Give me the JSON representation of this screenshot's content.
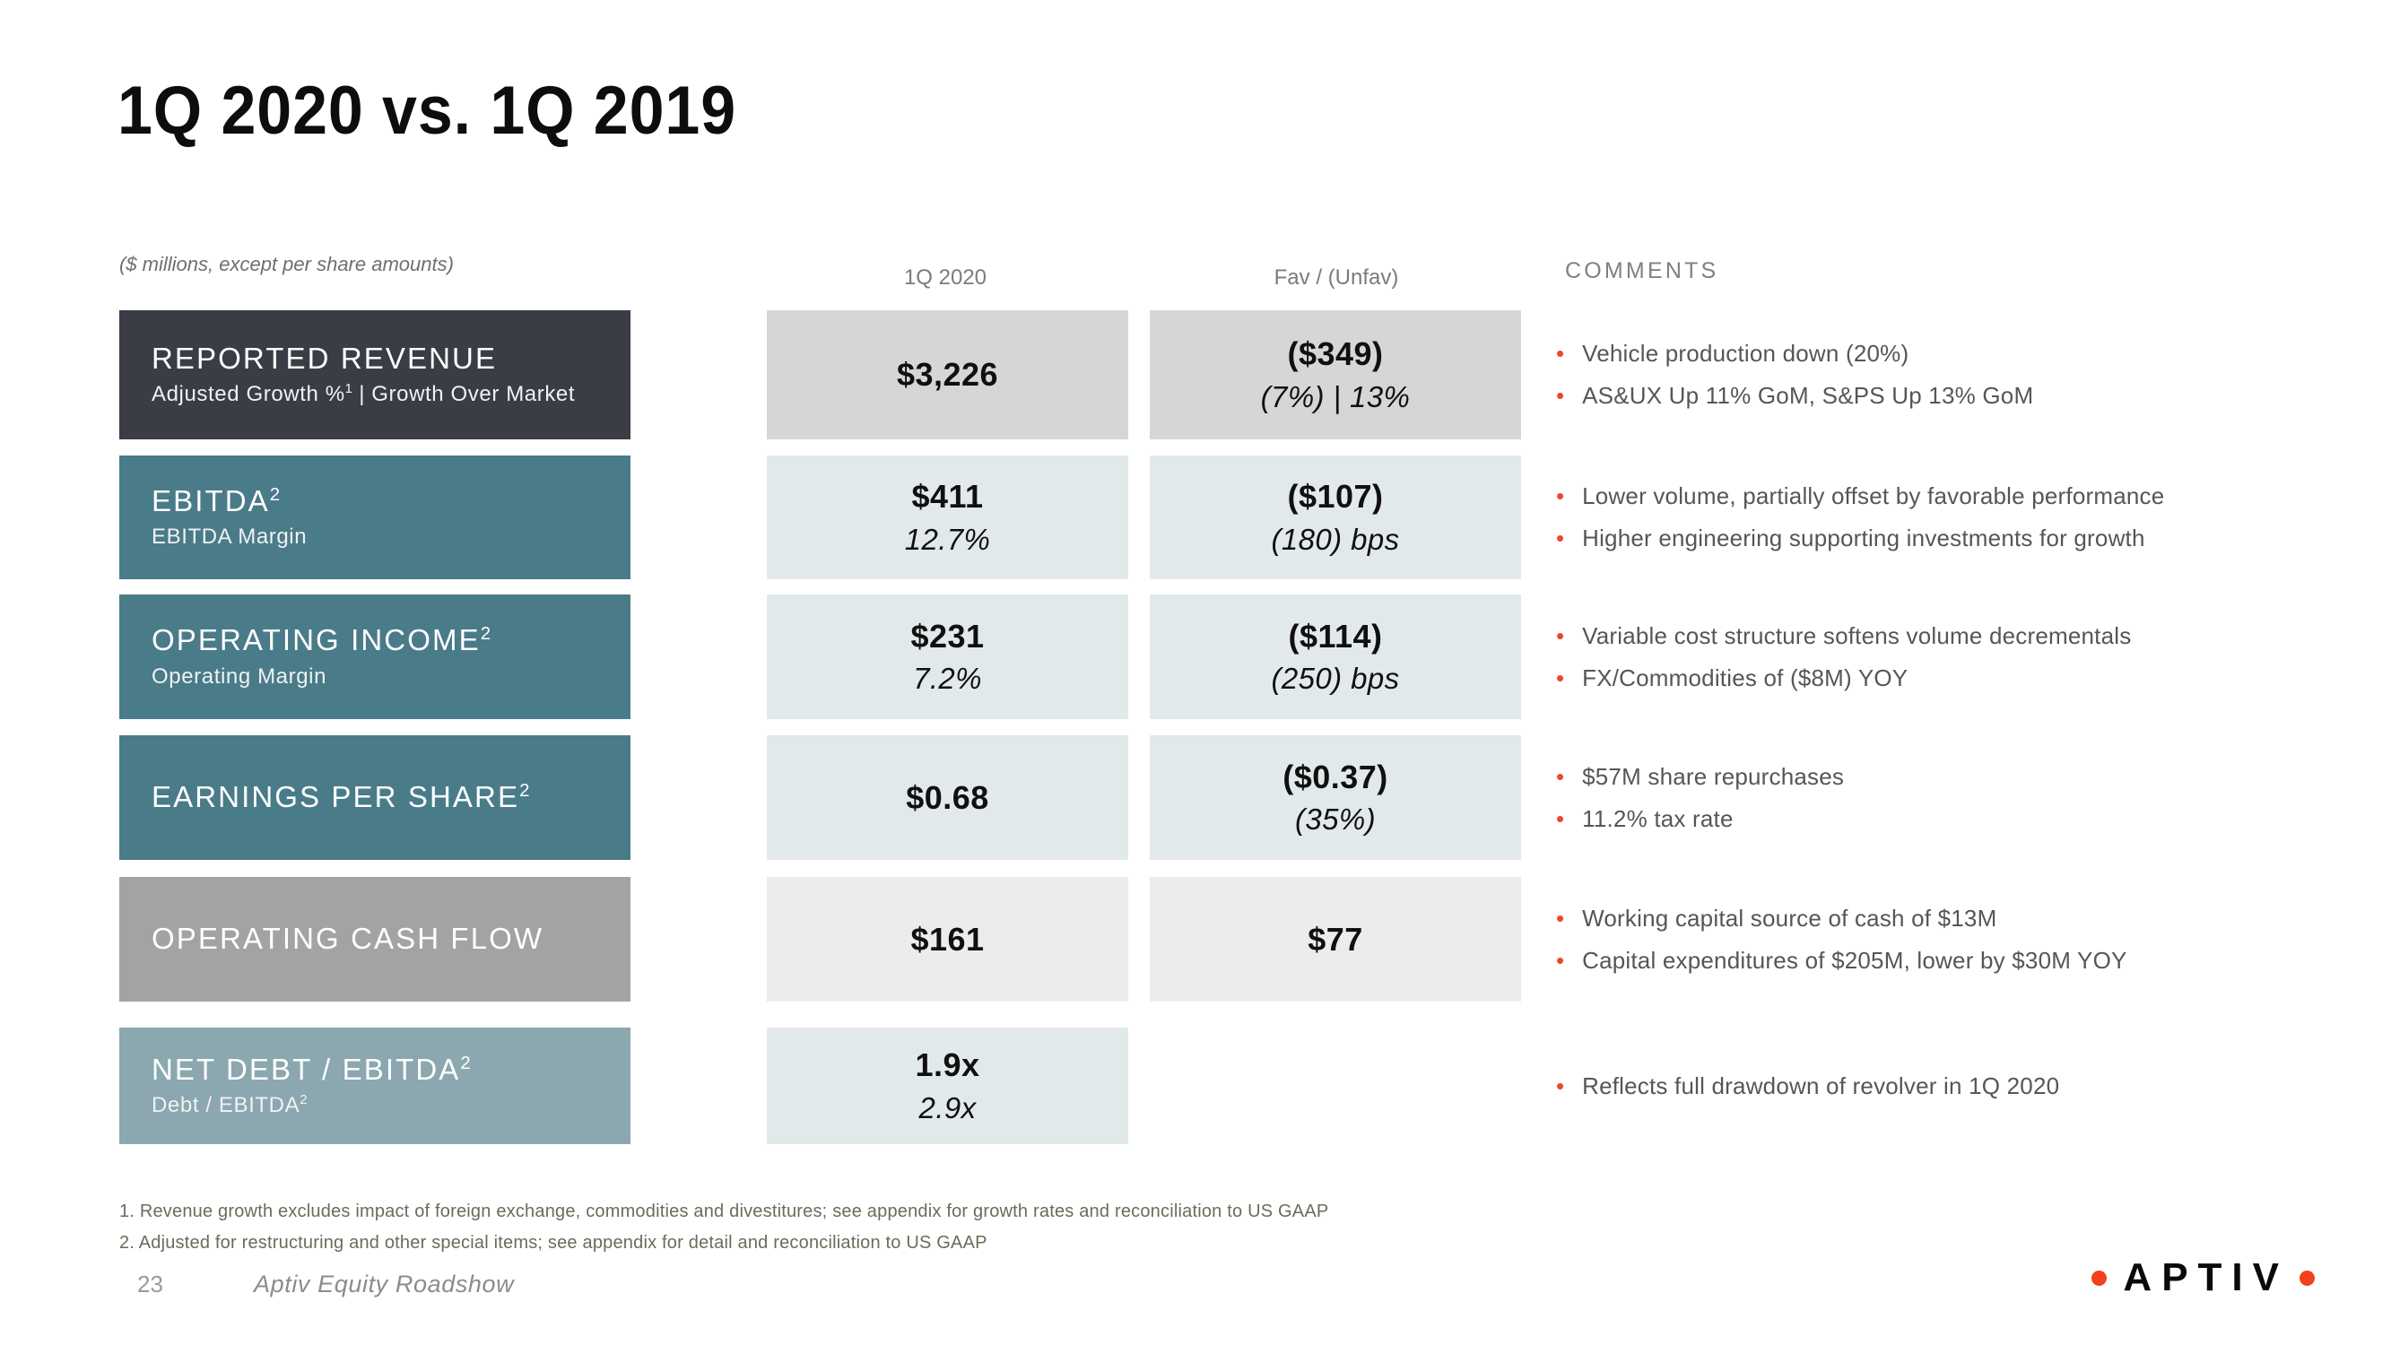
{
  "slide": {
    "title": "1Q 2020 vs. 1Q 2019",
    "units_note": "($ millions, except per share amounts)",
    "page_number": "23",
    "deck_name": "Aptiv Equity Roadshow"
  },
  "headers": {
    "period": "1Q 2020",
    "fav_unfav": "Fav / (Unfav)",
    "comments": "COMMENTS"
  },
  "colors": {
    "row1_label_bg": "#3b3d46",
    "row_teal_bg": "#4a7b89",
    "row_gray_bg": "#a3a3a3",
    "row_bluegray_bg": "#8ba7af",
    "value_bg_dark": "#d6d6d6",
    "value_bg_light": "#e2e9eb",
    "value_bg_neutral": "#ececec",
    "bullet": "#e8492b",
    "logo_dot": "#f1421b"
  },
  "rows": [
    {
      "label": "REPORTED REVENUE",
      "label_sup": "",
      "sublabel": "Adjusted Growth %",
      "sublabel_sup": "1",
      "sublabel_tail": " | Growth Over Market",
      "value": "$3,226",
      "value_sub": "",
      "delta": "($349)",
      "delta_sub": "(7%) | 13%",
      "comments": [
        "Vehicle production down (20%)",
        "AS&UX Up 11% GoM, S&PS Up 13% GoM"
      ]
    },
    {
      "label": "EBITDA",
      "label_sup": "2",
      "sublabel": "EBITDA Margin",
      "sublabel_sup": "",
      "sublabel_tail": "",
      "value": "$411",
      "value_sub": "12.7%",
      "delta": "($107)",
      "delta_sub": "(180) bps",
      "comments": [
        "Lower volume, partially offset by favorable performance",
        "Higher engineering supporting investments for growth"
      ]
    },
    {
      "label": "OPERATING INCOME",
      "label_sup": "2",
      "sublabel": "Operating Margin",
      "sublabel_sup": "",
      "sublabel_tail": "",
      "value": "$231",
      "value_sub": "7.2%",
      "delta": "($114)",
      "delta_sub": "(250) bps",
      "comments": [
        "Variable cost structure softens volume decrementals",
        "FX/Commodities of ($8M) YOY"
      ]
    },
    {
      "label": "EARNINGS PER SHARE",
      "label_sup": "2",
      "sublabel": "",
      "sublabel_sup": "",
      "sublabel_tail": "",
      "value": "$0.68",
      "value_sub": "",
      "delta": "($0.37)",
      "delta_sub": "(35%)",
      "comments": [
        "$57M share repurchases",
        "11.2% tax rate"
      ]
    },
    {
      "label": "OPERATING CASH FLOW",
      "label_sup": "",
      "sublabel": "",
      "sublabel_sup": "",
      "sublabel_tail": "",
      "value": "$161",
      "value_sub": "",
      "delta": "$77",
      "delta_sub": "",
      "comments": [
        "Working capital source of cash of $13M",
        "Capital expenditures of $205M, lower by $30M YOY"
      ]
    },
    {
      "label": "NET DEBT / EBITDA",
      "label_sup": "2",
      "sublabel": "Debt / EBITDA",
      "sublabel_sup": "2",
      "sublabel_tail": "",
      "value": "1.9x",
      "value_sub": "2.9x",
      "delta": "",
      "delta_sub": "",
      "comments": [
        "Reflects full drawdown of revolver in 1Q 2020"
      ]
    }
  ],
  "footnotes": [
    "1. Revenue growth excludes impact of foreign exchange, commodities and divestitures; see appendix for growth rates and reconciliation to US GAAP",
    "2. Adjusted for restructuring and other special items; see appendix for detail and reconciliation to US GAAP"
  ],
  "logo": {
    "word": "APTIV"
  }
}
